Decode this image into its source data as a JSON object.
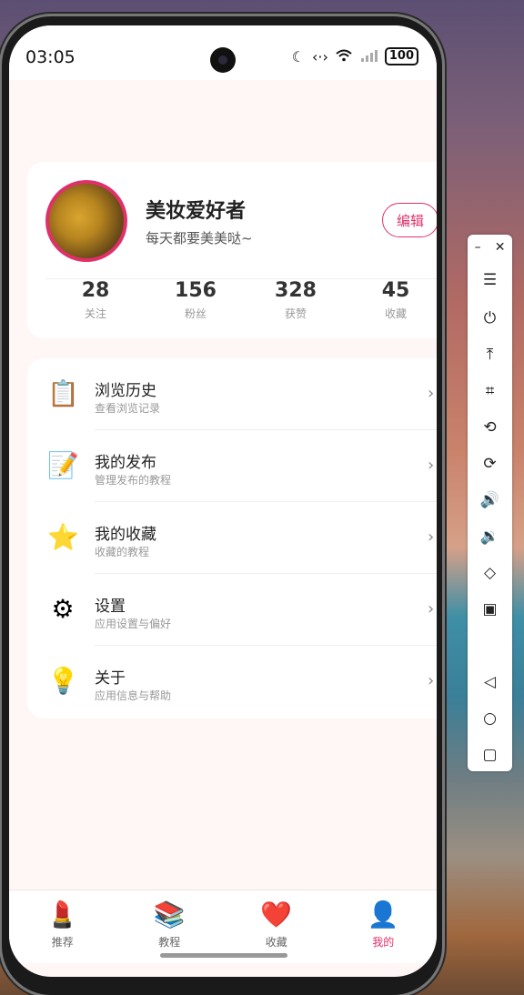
{
  "status_bar": {
    "time": "03:05",
    "battery": "100",
    "icons": [
      "moon-icon",
      "data-arrows-icon",
      "wifi-icon",
      "signal-icon",
      "battery-icon"
    ]
  },
  "profile": {
    "username": "美妆爱好者",
    "tagline": "每天都要美美哒~",
    "edit_label": "编辑",
    "stats": [
      {
        "value": "28",
        "label": "关注"
      },
      {
        "value": "156",
        "label": "粉丝"
      },
      {
        "value": "328",
        "label": "获赞"
      },
      {
        "value": "45",
        "label": "收藏"
      }
    ]
  },
  "menu": [
    {
      "title": "浏览历史",
      "subtitle": "查看浏览记录",
      "icon": "clipboard-icon"
    },
    {
      "title": "我的发布",
      "subtitle": "管理发布的教程",
      "icon": "memo-icon"
    },
    {
      "title": "我的收藏",
      "subtitle": "收藏的教程",
      "icon": "star-icon"
    },
    {
      "title": "设置",
      "subtitle": "应用设置与偏好",
      "icon": "gear-icon"
    },
    {
      "title": "关于",
      "subtitle": "应用信息与帮助",
      "icon": "lightbulb-icon"
    }
  ],
  "tabs": [
    {
      "label": "推荐",
      "icon": "lipstick-icon"
    },
    {
      "label": "教程",
      "icon": "books-icon"
    },
    {
      "label": "收藏",
      "icon": "heart-icon"
    },
    {
      "label": "我的",
      "icon": "user-icon",
      "active": true
    }
  ],
  "colors": {
    "accent": "#e0306a",
    "background": "#fff6f6"
  },
  "toolbar": [
    "minimize-icon",
    "close-icon",
    "menu-icon",
    "power-icon",
    "upload-icon",
    "crop-icon",
    "rotate-icon",
    "rotate-alt-icon",
    "volume-up-icon",
    "volume-down-icon",
    "screen-rotate-icon",
    "screenshot-icon",
    "back-icon",
    "home-icon",
    "recents-icon"
  ]
}
